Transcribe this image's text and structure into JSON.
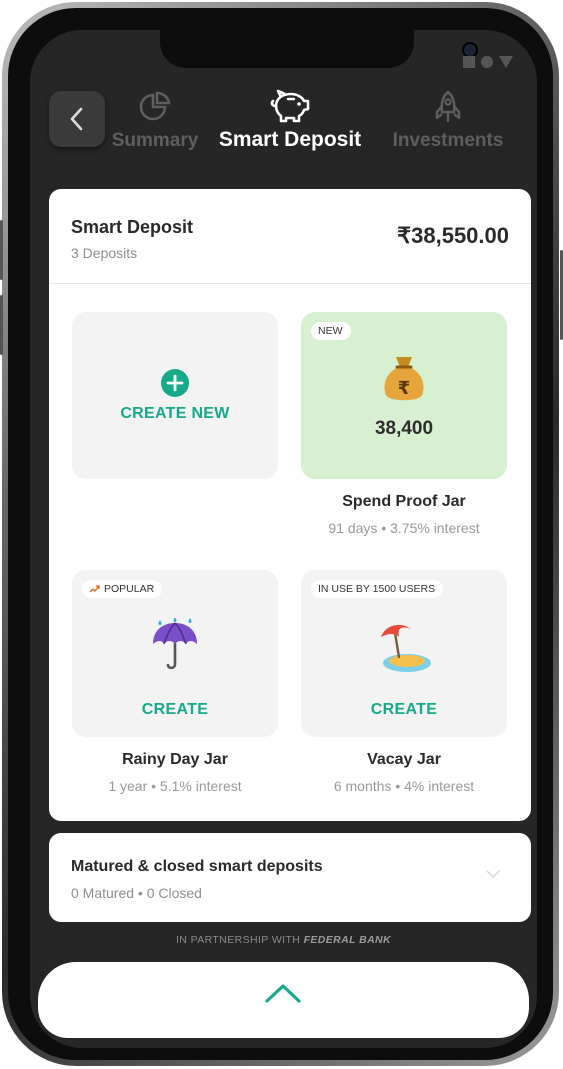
{
  "tabs": {
    "summary": "Summary",
    "smart_deposit": "Smart Deposit",
    "investments": "Investments"
  },
  "header": {
    "title": "Smart Deposit",
    "subtitle": "3 Deposits",
    "amount": "₹38,550.00"
  },
  "tiles": {
    "create_new": {
      "label": "CREATE NEW"
    },
    "spend_proof": {
      "badge": "NEW",
      "value": "38,400",
      "name": "Spend Proof Jar",
      "meta": "91 days • 3.75% interest"
    },
    "rainy_day": {
      "badge": "POPULAR",
      "action": "CREATE",
      "name": "Rainy Day Jar",
      "meta": "1 year • 5.1% interest"
    },
    "vacay": {
      "badge": "IN USE BY 1500 USERS",
      "action": "CREATE",
      "name": "Vacay Jar",
      "meta": "6 months • 4% interest"
    }
  },
  "matured": {
    "title": "Matured & closed smart deposits",
    "subtitle": "0 Matured • 0 Closed"
  },
  "partner": {
    "prefix": "IN PARTNERSHIP WITH",
    "bank": "FEDERAL BANK"
  },
  "colors": {
    "accent": "#16a98a",
    "screen_bg": "#262626",
    "jar_green": "#d7f0cf"
  }
}
